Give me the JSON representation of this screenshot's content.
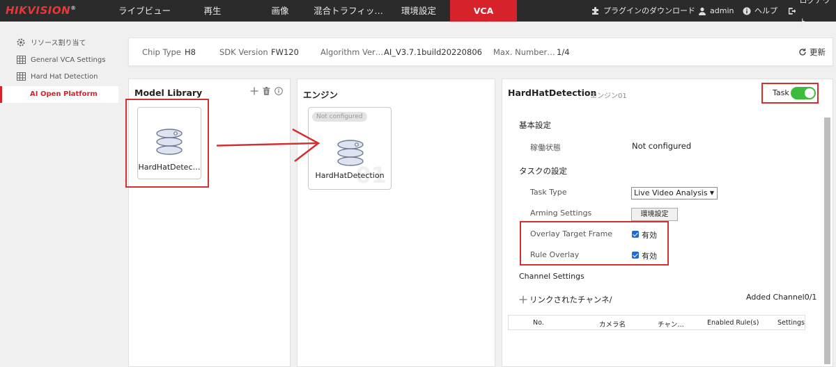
{
  "brand": {
    "logo": "HIKVISION",
    "reg": "®"
  },
  "nav": {
    "items": [
      "ライブビュー",
      "再生",
      "画像",
      "混合トラフィッ…",
      "環境設定",
      "VCA"
    ],
    "plugin_download": "プラグインのダウンロード",
    "user": "admin",
    "help": "ヘルプ",
    "logout": "ログアウト"
  },
  "sidebar": {
    "items": [
      "リソース割り当て",
      "General VCA Settings",
      "Hard Hat Detection",
      "AI Open Platform"
    ]
  },
  "info": {
    "chip_type_label": "Chip Type",
    "chip_type": "H8",
    "sdk_label": "SDK Version",
    "sdk": "FW120",
    "algo_label": "Algorithm Ver…",
    "algo": "AI_V3.7.1build20220806",
    "max_label": "Max. Number…",
    "max": "1/4",
    "refresh": "更新"
  },
  "model_library": {
    "title": "Model Library",
    "card_label": "HardHatDetec…"
  },
  "engine": {
    "title": "エンジン",
    "badge": "Not configured",
    "card_label": "HardHatDetection",
    "watermark": "01"
  },
  "detail": {
    "title": "HardHatDetection",
    "subtitle": "エンジン01",
    "task_label": "Task",
    "task_enabled": true,
    "basic_settings": "基本設定",
    "status_label": "稼働状態",
    "status_value": "Not configured",
    "task_settings": "タスクの設定",
    "task_type_label": "Task Type",
    "task_type_value": "Live Video Analysis",
    "arming_label": "Arming Settings",
    "arming_button": "環境設定",
    "overlay_frame_label": "Overlay Target Frame",
    "overlay_frame_value": "有効",
    "rule_overlay_label": "Rule Overlay",
    "rule_overlay_value": "有効",
    "channel_settings": "Channel Settings",
    "linked_channel": "リンクされたチャンネ/",
    "added_channel": "Added Channel0/1",
    "table_headers": [
      "No.",
      "カメラ名",
      "チャン…",
      "Enabled Rule(s)",
      "Settings"
    ]
  },
  "colors": {
    "accent": "#d7212b",
    "toggle_on": "#3dbb3d",
    "annotation": "#d32f2f"
  }
}
